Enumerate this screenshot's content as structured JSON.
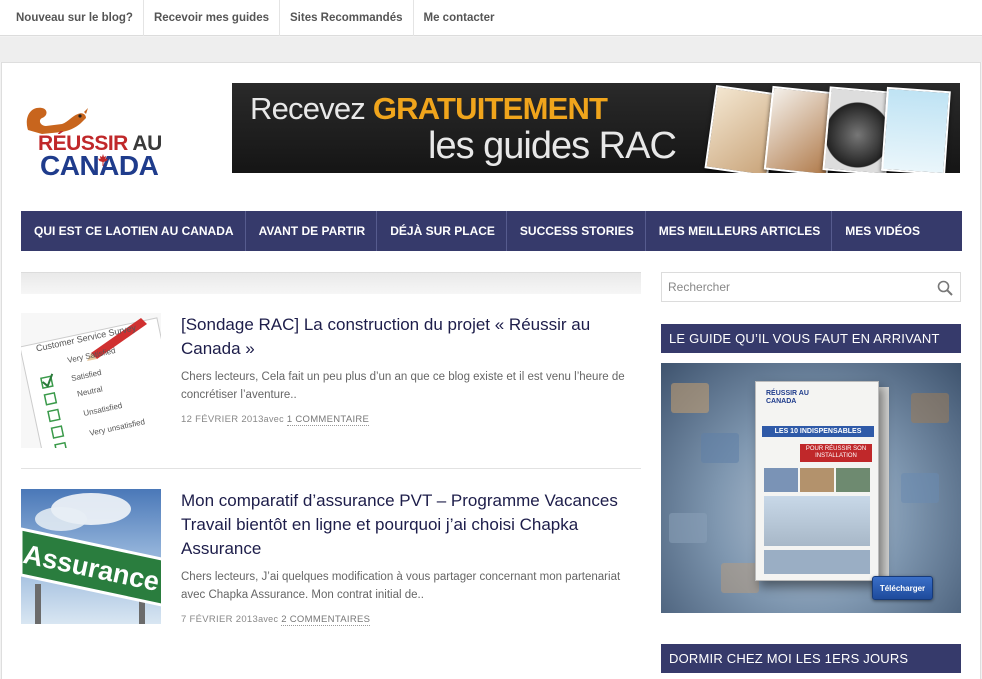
{
  "topbar": {
    "items": [
      "Nouveau sur le blog?",
      "Recevoir mes guides",
      "Sites Recommandés",
      "Me contacter"
    ]
  },
  "logo": {
    "line1_a": "RÉUSSIR",
    "line1_b": "AU",
    "line2": "CANADA"
  },
  "banner": {
    "line1_prefix": "Recevez ",
    "line1_highlight": "GRATUITEMENT",
    "line2": "les guides RAC"
  },
  "nav": {
    "items": [
      "QUI EST CE LAOTIEN AU CANADA",
      "AVANT DE PARTIR",
      "DÉJÀ SUR PLACE",
      "SUCCESS STORIES",
      "MES MEILLEURS ARTICLES",
      "MES VIDÉOS"
    ]
  },
  "posts": [
    {
      "title": "[Sondage RAC] La construction du projet « Réussir au Canada »",
      "excerpt": "Chers lecteurs, Cela fait un peu plus d’un an que ce blog existe et il est venu l’heure de concrétiser l’aventure..",
      "date": "12 FÉVRIER 2013",
      "avec": "avec",
      "comments": "1 COMMENTAIRE",
      "thumb_text": [
        "Customer Service Survey",
        "Very Satisfied",
        "Satisfied",
        "Neutral",
        "Unsatisfied",
        "Very unsatisfied"
      ]
    },
    {
      "title": "Mon comparatif d’assurance PVT – Programme Vacances Travail bientôt en ligne et pourquoi j’ai choisi Chapka Assurance",
      "excerpt": "Chers lecteurs, J’ai quelques modification à vous partager concernant mon partenariat avec Chapka Assurance. Mon contrat initial de..",
      "date": "7 FÉVRIER 2013",
      "avec": "avec",
      "comments": "2 COMMENTAIRES",
      "thumb_text": "Assurance"
    }
  ],
  "sidebar": {
    "search_placeholder": "Rechercher",
    "widget1_title": "LE GUIDE QU’IL VOUS FAUT EN ARRIVANT",
    "guide": {
      "box_logo": "RÉUSSIR AU CANADA",
      "box_title": "LES 10 INDISPENSABLES",
      "box_sub": "POUR RÉUSSIR SON INSTALLATION",
      "download_label": "Télécharger"
    },
    "widget2_title": "DORMIR CHEZ MOI LES 1ERS JOURS"
  },
  "colors": {
    "nav_bg": "#363a6b",
    "banner_highlight": "#f0a51c",
    "logo_red": "#c0282a",
    "logo_blue": "#1f3c8c"
  }
}
